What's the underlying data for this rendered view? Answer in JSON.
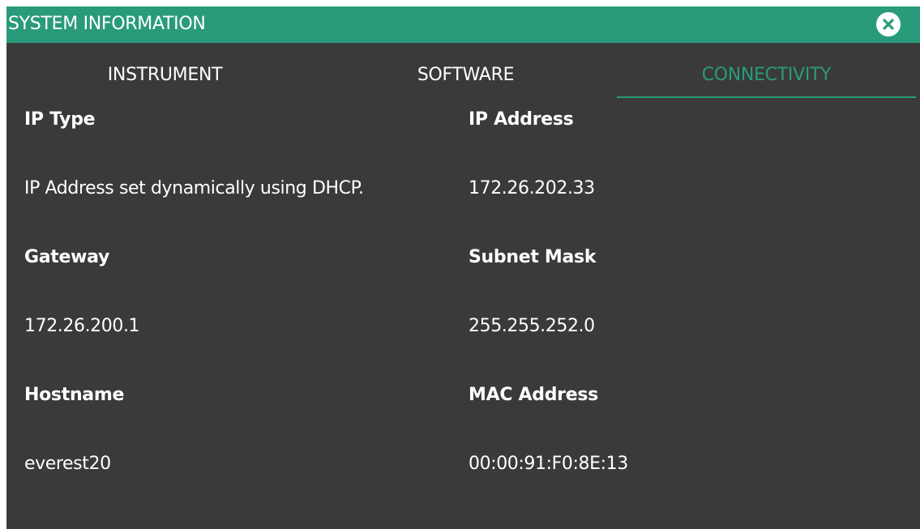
{
  "dialog": {
    "title": "SYSTEM INFORMATION",
    "close_icon": "close-circle-icon"
  },
  "tabs": [
    {
      "label": "INSTRUMENT",
      "active": false
    },
    {
      "label": "SOFTWARE",
      "active": false
    },
    {
      "label": "CONNECTIVITY",
      "active": true
    }
  ],
  "connectivity": {
    "ip_type": {
      "label": "IP Type",
      "value": "IP Address set dynamically using DHCP."
    },
    "ip_address": {
      "label": "IP Address",
      "value": "172.26.202.33"
    },
    "gateway": {
      "label": "Gateway",
      "value": "172.26.200.1"
    },
    "subnet_mask": {
      "label": "Subnet Mask",
      "value": "255.255.252.0"
    },
    "hostname": {
      "label": "Hostname",
      "value": "everest20"
    },
    "mac_address": {
      "label": "MAC Address",
      "value": "00:00:91:F0:8E:13"
    }
  },
  "colors": {
    "accent": "#2a9b7a",
    "background": "#3a3a3a",
    "text": "#ffffff"
  }
}
